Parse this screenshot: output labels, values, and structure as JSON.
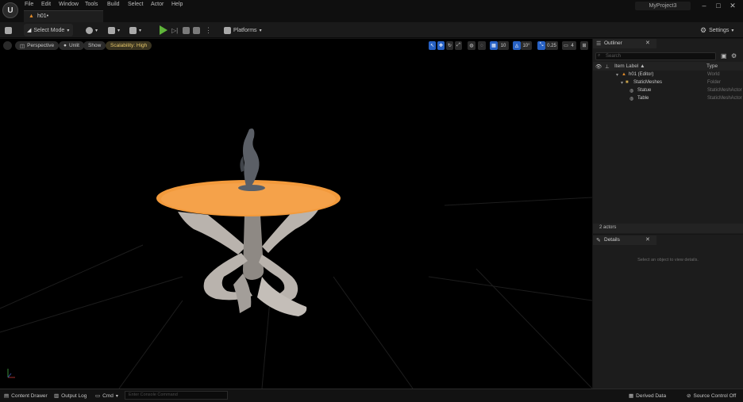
{
  "menu": [
    "File",
    "Edit",
    "Window",
    "Tools",
    "Build",
    "Select",
    "Actor",
    "Help"
  ],
  "document_tab": "h01•",
  "project_name": "MyProject3",
  "toolbar": {
    "select_mode": "Select Mode",
    "platforms": "Platforms",
    "settings": "Settings"
  },
  "viewport": {
    "perspective": "Perspective",
    "unlit": "Unlit",
    "show": "Show",
    "scalability": "Scalability: High",
    "grid_snap": "10",
    "rotation_snap": "10°",
    "scale_snap": "0.25",
    "camera_speed": "4"
  },
  "outliner": {
    "tab_label": "Outliner",
    "search_placeholder": "Search",
    "col_label": "Item Label ▲",
    "col_type": "Type",
    "rows": [
      {
        "label": "h01 (Editor)",
        "type": "World"
      },
      {
        "label": "StaticMeshes",
        "type": "Folder"
      },
      {
        "label": "Statue",
        "type": "StaticMeshActor"
      },
      {
        "label": "Table",
        "type": "StaticMeshActor"
      }
    ],
    "actor_count": "2 actors"
  },
  "details": {
    "tab_label": "Details",
    "empty_text": "Select an object to view details."
  },
  "statusbar": {
    "content_drawer": "Content Drawer",
    "output_log": "Output Log",
    "cmd": "Cmd",
    "console_placeholder": "Enter Console Command",
    "derived_data": "Derived Data",
    "source_control": "Source Control Off"
  },
  "colors": {
    "table_top": "#f29a3c",
    "table_legs": "#b9b3ad",
    "accent_blue": "#2761c4",
    "play_green": "#5fb43a"
  }
}
